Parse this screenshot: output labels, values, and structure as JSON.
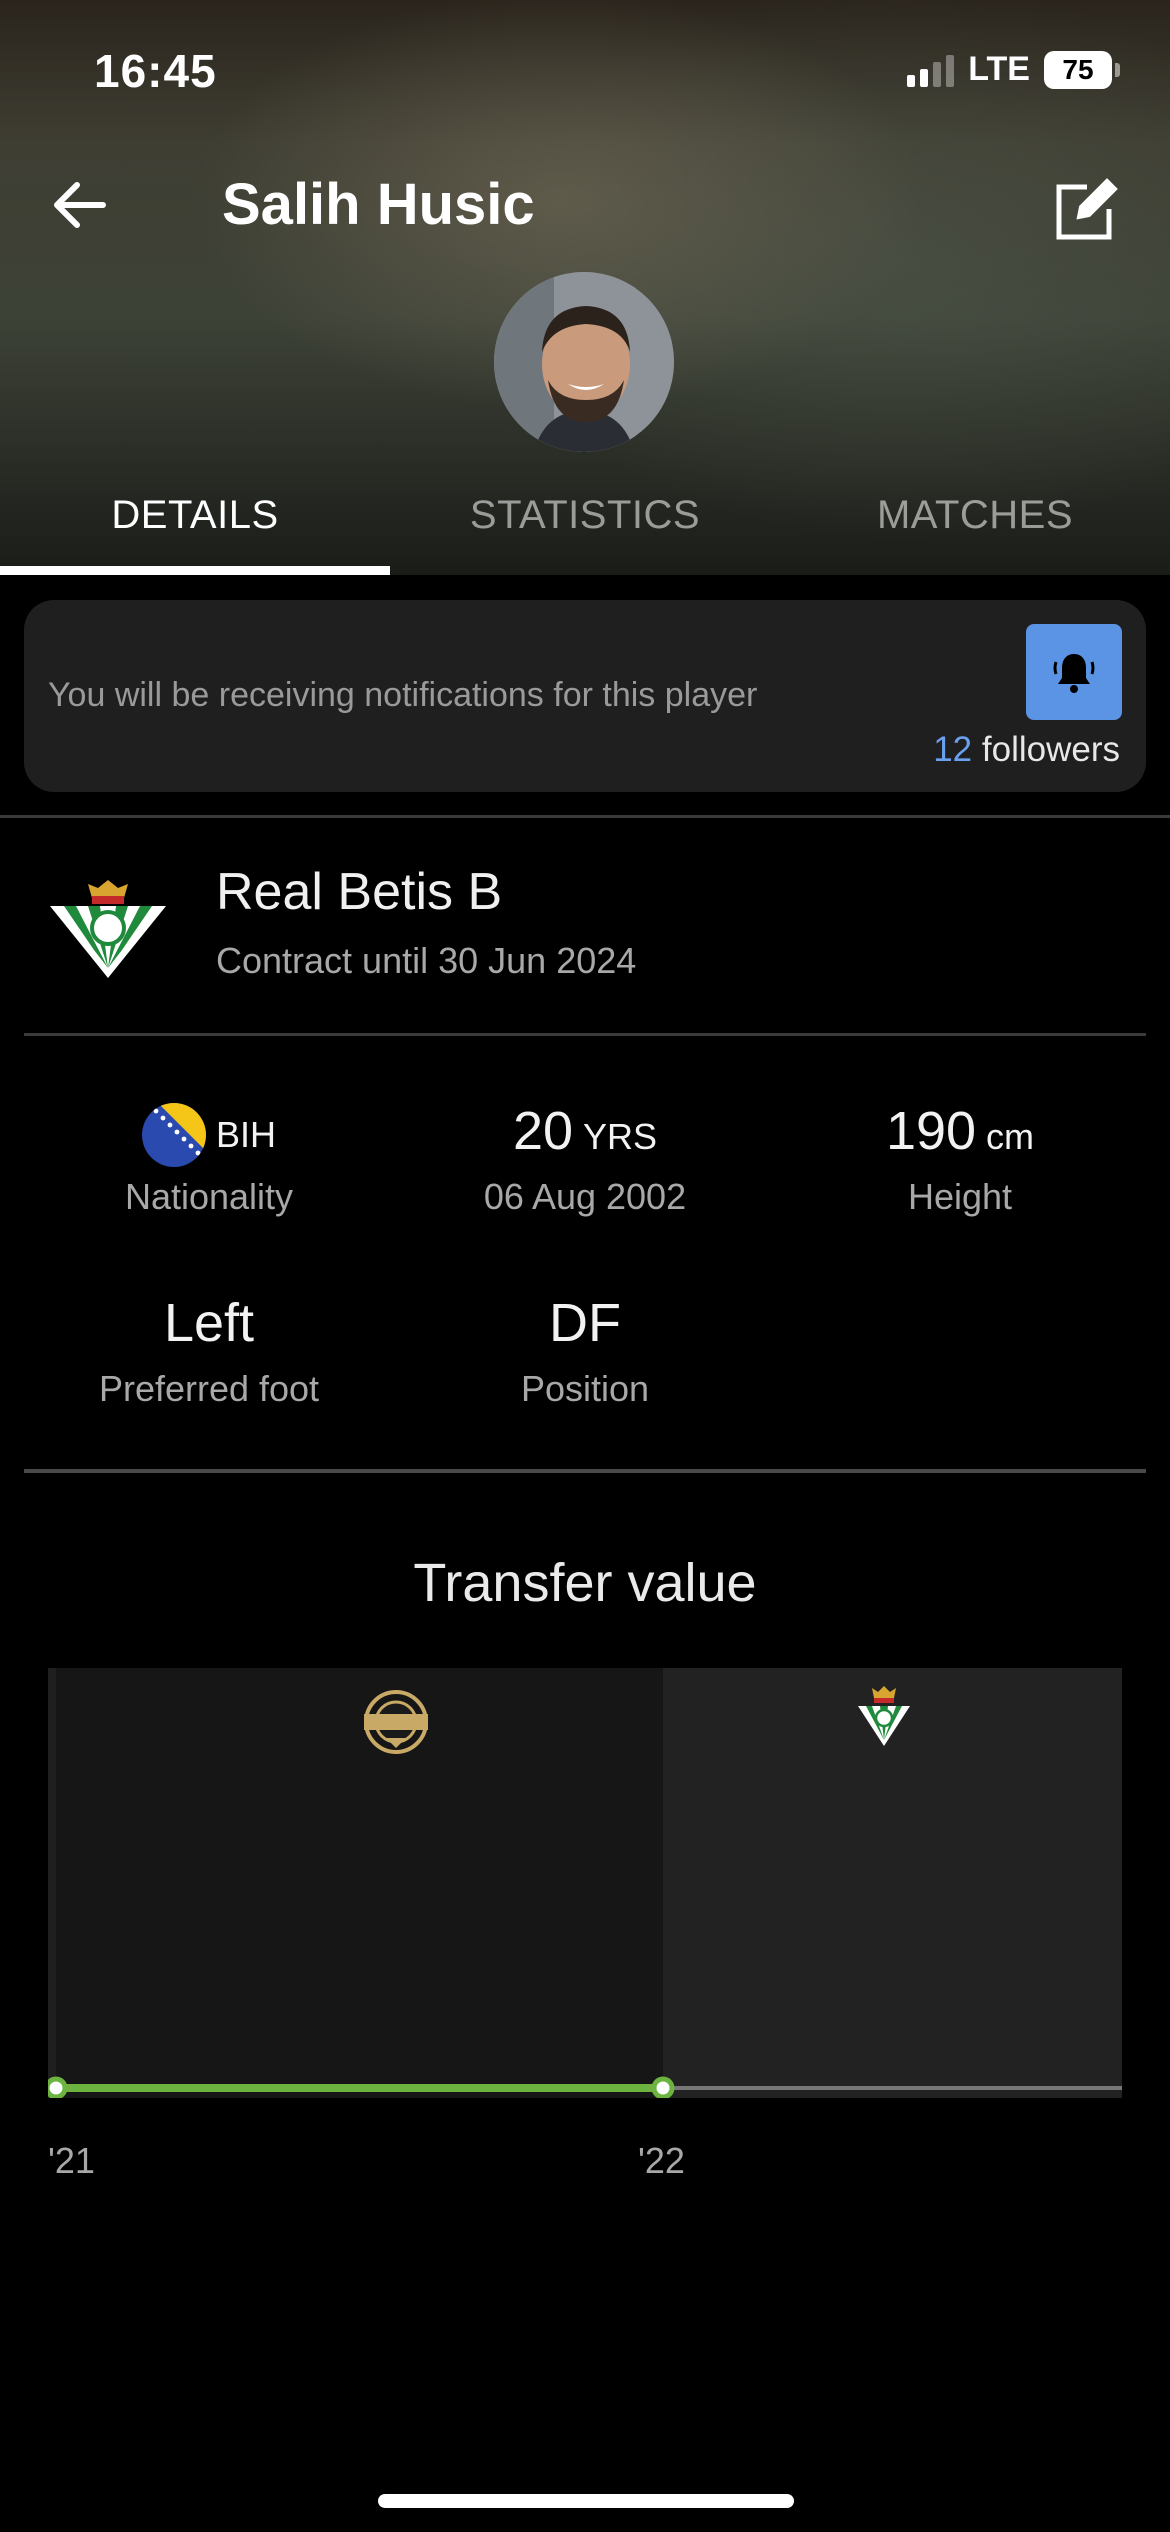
{
  "status_bar": {
    "time": "16:45",
    "network": "LTE",
    "battery": "75"
  },
  "header": {
    "title": "Salih Husic"
  },
  "tabs": [
    {
      "label": "DETAILS",
      "active": true
    },
    {
      "label": "STATISTICS",
      "active": false
    },
    {
      "label": "MATCHES",
      "active": false
    }
  ],
  "notification": {
    "message": "You will be receiving notifications for this player",
    "followers_count": "12",
    "followers_label": "followers"
  },
  "team": {
    "name": "Real Betis B",
    "contract": "Contract until 30 Jun 2024"
  },
  "details": {
    "nationality": {
      "code": "BIH",
      "label": "Nationality"
    },
    "age": {
      "value": "20",
      "unit": "YRS",
      "label": "06 Aug 2002"
    },
    "height": {
      "value": "190",
      "unit": "cm",
      "label": "Height"
    },
    "foot": {
      "value": "Left",
      "label": "Preferred foot"
    },
    "position": {
      "value": "DF",
      "label": "Position"
    }
  },
  "transfer_value": {
    "title": "Transfer value",
    "ticks": [
      "'21",
      "'22"
    ]
  },
  "colors": {
    "accent_blue": "#5b94e4",
    "followers_blue": "#6aa0ee",
    "timeline_green": "#6db33f"
  }
}
